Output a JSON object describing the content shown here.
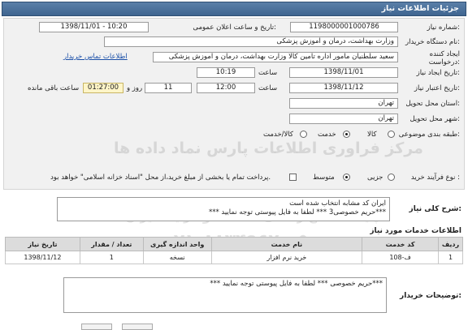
{
  "header": {
    "title": "جزئیات اطلاعات نیاز"
  },
  "fields": {
    "need_number_label": "شماره نیاز:",
    "need_number": "1198000001000786",
    "announce_label": "تاریخ و ساعت اعلان عمومی:",
    "announce_value": "1398/11/01 - 10:20",
    "buyer_org_label": "نام دستگاه خریدار:",
    "buyer_org": "وزارت بهداشت، درمان و آموزش پزشکی",
    "creator_label": "ایجاد کننده درخواست:",
    "creator": "سعید سلطنیان مامور اداره تامین کالا وزارت بهداشت، درمان و آموزش پزشکی",
    "contact_link": "اطلاعات تماس خریدار",
    "created_date_label": "تاریخ ایجاد نیاز:",
    "created_date": "1398/11/01",
    "created_time_label": "ساعت",
    "created_time": "10:19",
    "deadline_label": "تاریخ اعتبار نیاز:",
    "deadline_date": "1398/11/12",
    "deadline_time_label": "ساعت",
    "deadline_time": "12:00",
    "days": "11",
    "days_label": "روز و",
    "remaining": "01:27:00",
    "remaining_label": "ساعت باقی مانده",
    "province_label": "استان محل تحویل:",
    "province": "تهران",
    "city_label": "شهر محل تحویل:",
    "city": "تهران",
    "category_label": "طبقه بندی موضوعی:",
    "category_options": [
      "کالا",
      "خدمت",
      "کالا/خدمت"
    ],
    "purchase_type_label": "نوع فرآیند خرید :",
    "purchase_options": [
      "جزیی",
      "متوسط"
    ],
    "payment_note": "پرداخت تمام یا بخشی از مبلغ خرید،از محل \"اسناد خزانه اسلامی\" خواهد بود."
  },
  "summary": {
    "label": "شرح کلی نیاز:",
    "line1": "ایران کد مشابه انتخاب شده است",
    "line2": "*** حریم خصوصی3 *** لطفا به فایل پیوستی توجه نمایید***"
  },
  "services": {
    "title": "اطلاعات خدمات مورد نیاز",
    "columns": [
      "ردیف",
      "کد خدمت",
      "نام خدمت",
      "واحد اندازه گیری",
      "تعداد / مقدار",
      "تاریخ نیاز"
    ],
    "rows": [
      {
        "row": "1",
        "code": "ف-108",
        "name": "خرید نرم افزار",
        "unit": "نسخه",
        "qty": "1",
        "date": "1398/11/12"
      }
    ]
  },
  "buyer_notes": {
    "label": "توضیحات خریدار:",
    "text": "*** حریم خصوصی *** لطفا به فایل پیوستی توجه نمایید***"
  },
  "watermark": {
    "line1": "مرکز فراوری اطلاعات پارس نماد داده ها",
    "line2": "پایگاه اطلاع رسانی مناقصه و مزایده ایران",
    "phone": "۰۲۱-۸۸۳۴۹۶۷۰-۵"
  },
  "colors": {
    "header": "#4a7099",
    "remaining_bg": "#fff5c8",
    "link": "#1a4fa8"
  }
}
